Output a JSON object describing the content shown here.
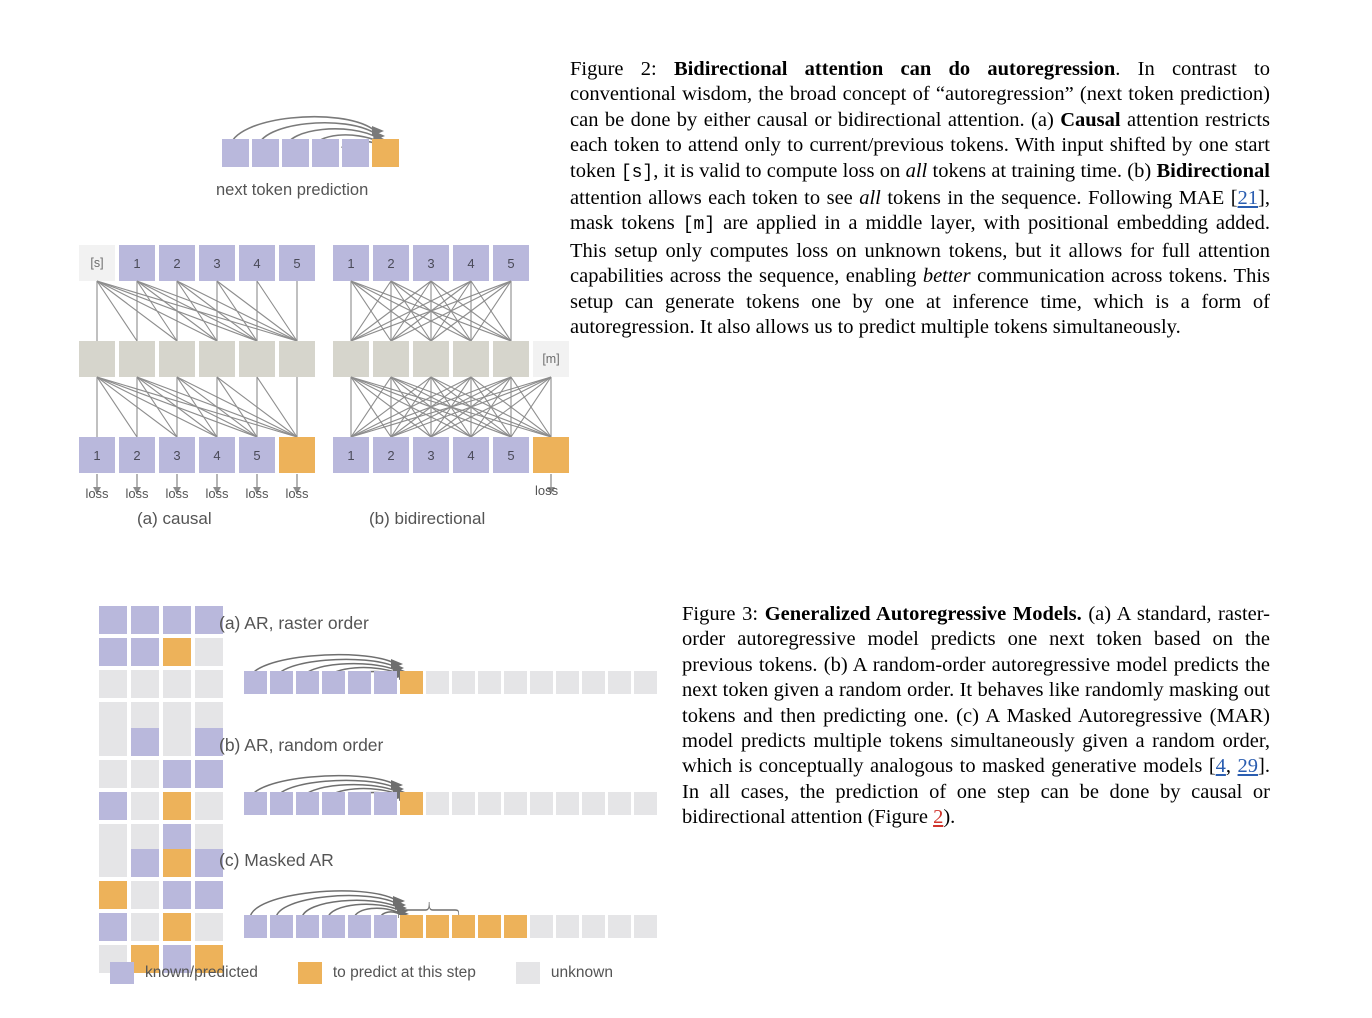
{
  "figure2": {
    "number": "Figure 2:",
    "title": "Bidirectional attention can do autoregression",
    "body_1": ". In contrast to conventional wisdom, the broad concept of “autoregression” (next token prediction) can be done by either causal or bidirectional attention. (a) ",
    "bold_causal": "Causal",
    "body_2": " attention restricts each token to attend only to current/previous tokens. With input shifted by one start token ",
    "mono_s": "[s]",
    "body_3": ", it is valid to compute loss on ",
    "italic_all_1": "all",
    "body_4": " tokens at training time. (b) ",
    "bold_bidirectional": "Bidirectional",
    "body_5": " attention allows each token to see ",
    "italic_all_2": "all",
    "body_6": " tokens in the sequence. Following MAE [",
    "cite_21": "21",
    "body_7": "], mask tokens ",
    "mono_m": "[m]",
    "body_8": " are applied in a middle layer, with positional embedding added. This setup only computes loss on unknown tokens, but it allows for full attention capabilities across the sequence, enabling ",
    "italic_better": "better",
    "body_9": " communication across tokens. This setup can generate tokens one by one at inference time, which is a form of autoregression. It also allows us to predict multiple tokens simultaneously.",
    "diagram": {
      "top_caption": "next token prediction",
      "top_sequence": [
        "known",
        "known",
        "known",
        "known",
        "known",
        "predict"
      ],
      "causal": {
        "label": "(a) causal",
        "input_row": [
          "[s]",
          "1",
          "2",
          "3",
          "4",
          "5"
        ],
        "input_kinds": [
          "start",
          "known",
          "known",
          "known",
          "known",
          "known"
        ],
        "middle_row": [
          "",
          "",
          "",
          "",
          "",
          ""
        ],
        "output_row": [
          "1",
          "2",
          "3",
          "4",
          "5",
          ""
        ],
        "output_kinds": [
          "known",
          "known",
          "known",
          "known",
          "known",
          "predict"
        ],
        "loss_labels": [
          "loss",
          "loss",
          "loss",
          "loss",
          "loss",
          "loss"
        ]
      },
      "bidirectional": {
        "label": "(b) bidirectional",
        "input_row": [
          "1",
          "2",
          "3",
          "4",
          "5"
        ],
        "input_kinds": [
          "known",
          "known",
          "known",
          "known",
          "known"
        ],
        "middle_row": [
          "",
          "",
          "",
          "",
          "",
          "[m]"
        ],
        "middle_kinds": [
          "mid",
          "mid",
          "mid",
          "mid",
          "mid",
          "mask"
        ],
        "output_row": [
          "1",
          "2",
          "3",
          "4",
          "5",
          ""
        ],
        "output_kinds": [
          "known",
          "known",
          "known",
          "known",
          "known",
          "predict"
        ],
        "loss_labels": [
          "loss"
        ]
      }
    }
  },
  "figure3": {
    "number": "Figure 3:",
    "title": "Generalized Autoregressive Models.",
    "body_1": " (a) A standard, raster-order autoregressive model predicts one next token based on the previous tokens. (b) A random-order autoregressive model predicts the next token given a random order. It behaves like randomly masking out tokens and then predicting one. (c) A Masked Autoregressive (MAR) model predicts multiple tokens simultaneously given a random order, which is conceptually analogous to masked generative models [",
    "cite_4": "4",
    "body_2": ", ",
    "cite_29": "29",
    "body_3": "]. In all cases, the prediction of one step can be done by causal or bidirectional attention (Figure ",
    "cite_fig2": "2",
    "body_4": ").",
    "panels": [
      {
        "label": "(a) AR, raster order",
        "grid": [
          [
            "known",
            "known",
            "known",
            "known"
          ],
          [
            "known",
            "known",
            "predict",
            "unknown"
          ],
          [
            "unknown",
            "unknown",
            "unknown",
            "unknown"
          ],
          [
            "unknown",
            "unknown",
            "unknown",
            "unknown"
          ]
        ],
        "sequence": [
          "known",
          "known",
          "known",
          "known",
          "known",
          "known",
          "predict",
          "unknown",
          "unknown",
          "unknown",
          "unknown",
          "unknown",
          "unknown",
          "unknown",
          "unknown",
          "unknown"
        ],
        "arrow_count": 6,
        "bracket": false
      },
      {
        "label": "(b) AR, random order",
        "grid": [
          [
            "unknown",
            "known",
            "unknown",
            "known"
          ],
          [
            "unknown",
            "unknown",
            "known",
            "known"
          ],
          [
            "known",
            "unknown",
            "predict",
            "unknown"
          ],
          [
            "unknown",
            "unknown",
            "known",
            "unknown"
          ]
        ],
        "sequence": [
          "known",
          "known",
          "known",
          "known",
          "known",
          "known",
          "predict",
          "unknown",
          "unknown",
          "unknown",
          "unknown",
          "unknown",
          "unknown",
          "unknown",
          "unknown",
          "unknown"
        ],
        "arrow_count": 6,
        "bracket": false
      },
      {
        "label": "(c) Masked AR",
        "grid": [
          [
            "unknown",
            "known",
            "predict",
            "known"
          ],
          [
            "predict",
            "unknown",
            "known",
            "known"
          ],
          [
            "known",
            "unknown",
            "predict",
            "unknown"
          ],
          [
            "unknown",
            "predict",
            "known",
            "predict"
          ]
        ],
        "sequence": [
          "known",
          "known",
          "known",
          "known",
          "known",
          "known",
          "predict",
          "predict",
          "predict",
          "predict",
          "predict",
          "unknown",
          "unknown",
          "unknown",
          "unknown",
          "unknown"
        ],
        "arrow_count": 6,
        "bracket": true
      }
    ],
    "legend": [
      {
        "swatch": "known",
        "label": "known/predicted"
      },
      {
        "swatch": "predict",
        "label": "to predict at this step"
      },
      {
        "swatch": "unknown",
        "label": "unknown"
      }
    ]
  },
  "colors": {
    "known": "#b9b8dc",
    "predict": "#edb25a",
    "unknown": "#e5e5e7",
    "middle": "#d6d5cc",
    "mask": "#f2f2f2",
    "start": "#f2f2f2",
    "arrow": "#7a7a7a",
    "text": "#545454",
    "cite_blue": "#2a5db0",
    "cite_red": "#d0342c"
  }
}
